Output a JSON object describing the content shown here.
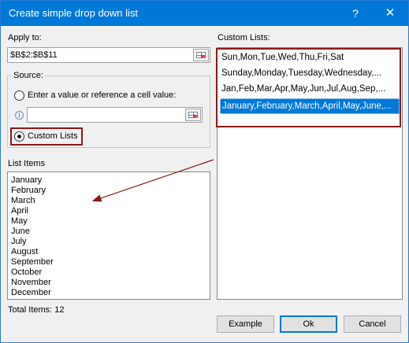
{
  "window": {
    "title": "Create simple drop down list",
    "help_glyph": "?",
    "close_glyph": "✕"
  },
  "apply_to": {
    "label": "Apply to:",
    "value": "$B$2:$B$11"
  },
  "source": {
    "label": "Source:",
    "option_value_label": "Enter a value or reference a cell value:",
    "option_value_selected": false,
    "option_custom_label": "Custom Lists",
    "option_custom_selected": true,
    "value_input": "",
    "info_glyph": "i"
  },
  "list_items": {
    "label": "List Items",
    "items": [
      "January",
      "February",
      "March",
      "April",
      "May",
      "June",
      "July",
      "August",
      "September",
      "October",
      "November",
      "December"
    ],
    "total_label": "Total Items: 12"
  },
  "custom_lists": {
    "label": "Custom Lists:",
    "rows": [
      "Sun,Mon,Tue,Wed,Thu,Fri,Sat",
      "Sunday,Monday,Tuesday,Wednesday,...",
      "Jan,Feb,Mar,Apr,May,Jun,Jul,Aug,Sep,...",
      "January,February,March,April,May,June,..."
    ],
    "selected_index": 3
  },
  "buttons": {
    "example": "Example",
    "ok": "Ok",
    "cancel": "Cancel"
  },
  "colors": {
    "titlebar": "#0078d7",
    "highlight_box": "#8b1a1a",
    "selection": "#0078d7"
  }
}
